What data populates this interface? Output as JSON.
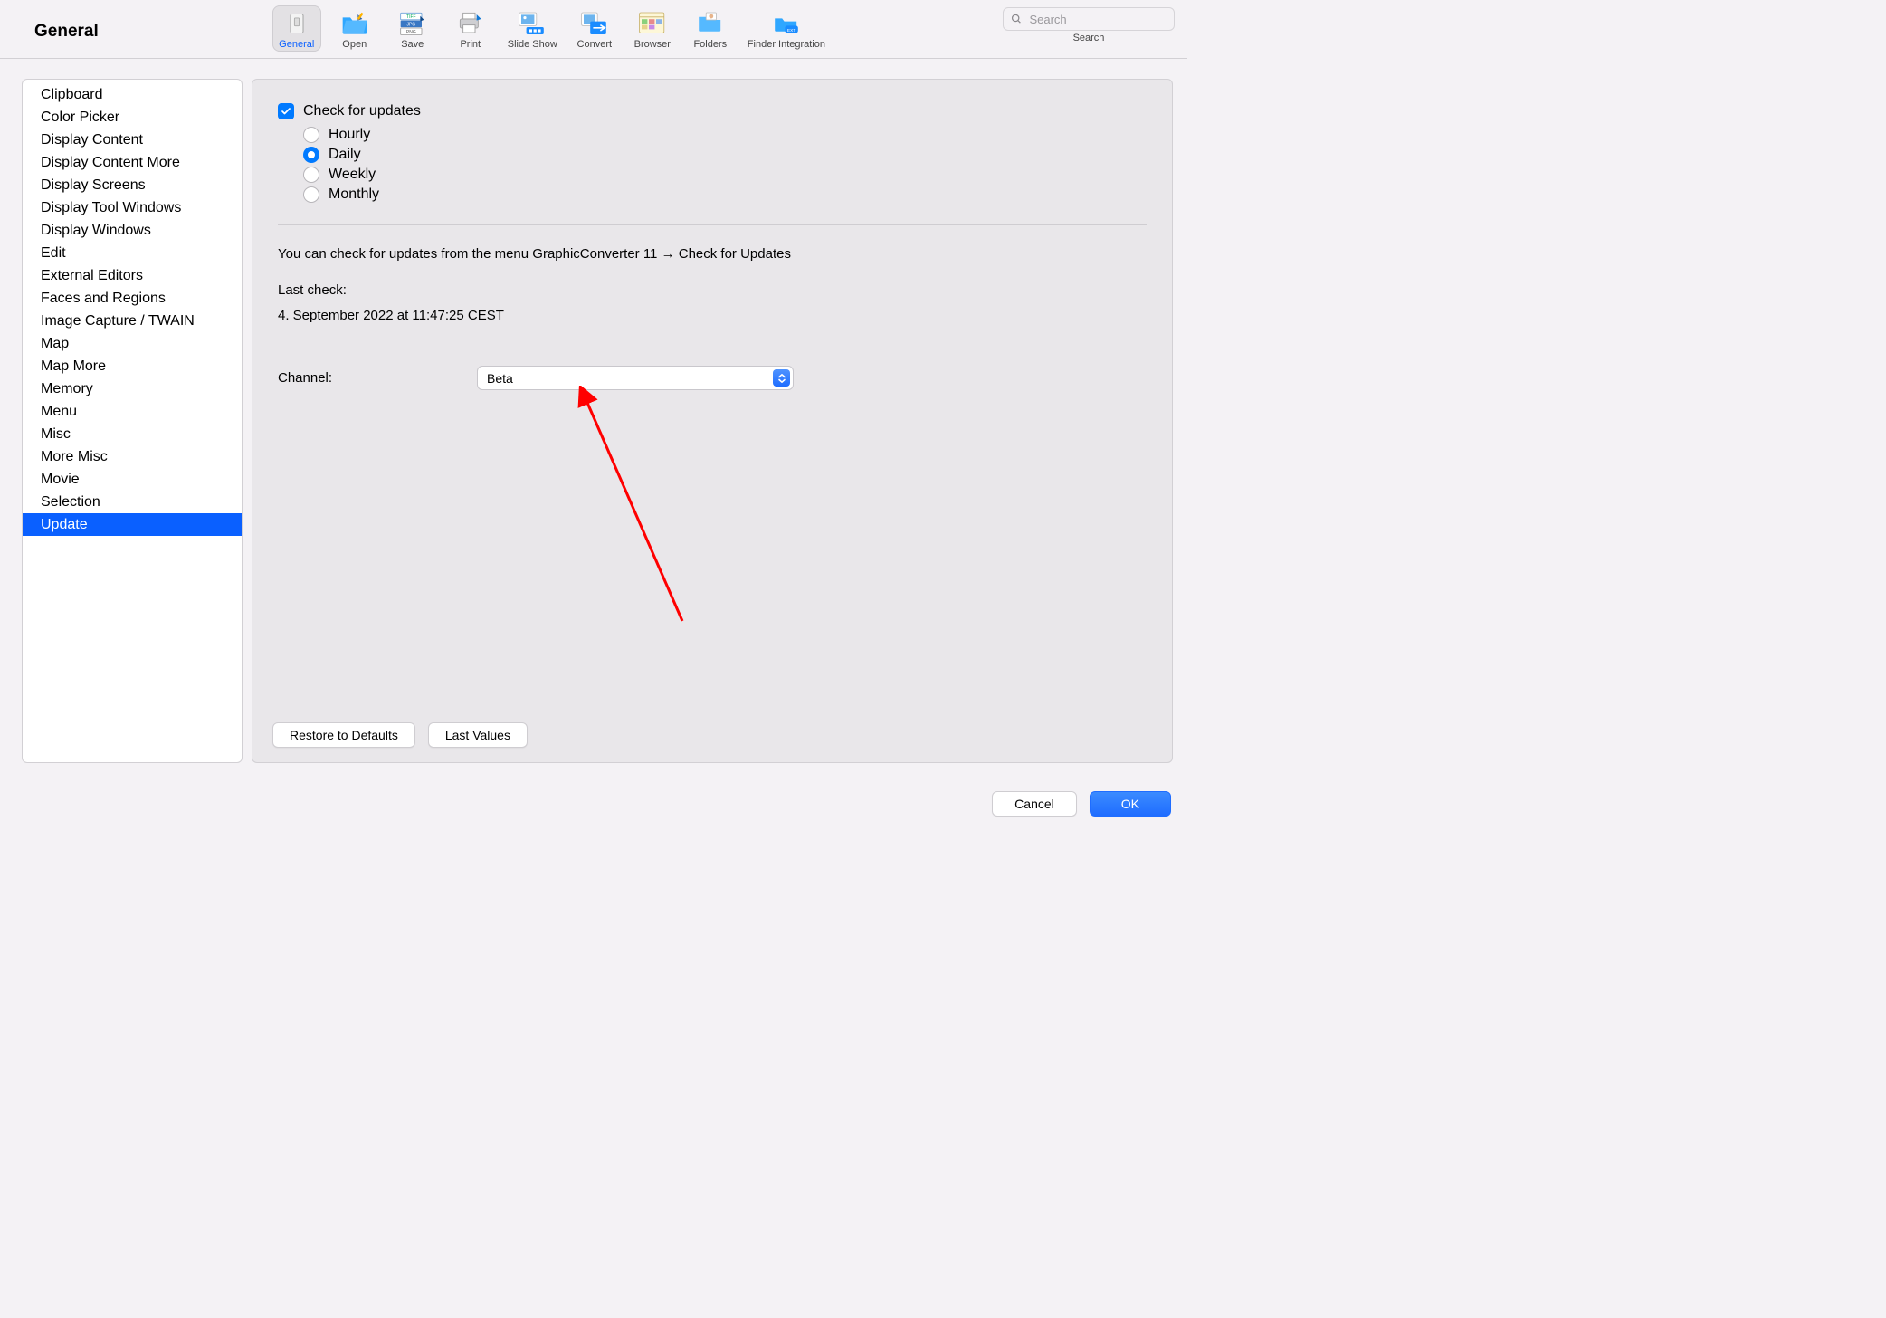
{
  "page_title": "General",
  "toolbar": {
    "items": [
      {
        "label": "General",
        "name": "tab-general",
        "icon": "general",
        "active": true
      },
      {
        "label": "Open",
        "name": "tab-open",
        "icon": "open"
      },
      {
        "label": "Save",
        "name": "tab-save",
        "icon": "save"
      },
      {
        "label": "Print",
        "name": "tab-print",
        "icon": "print"
      },
      {
        "label": "Slide Show",
        "name": "tab-slideshow",
        "icon": "slideshow"
      },
      {
        "label": "Convert",
        "name": "tab-convert",
        "icon": "convert"
      },
      {
        "label": "Browser",
        "name": "tab-browser",
        "icon": "browser"
      },
      {
        "label": "Folders",
        "name": "tab-folders",
        "icon": "folders"
      },
      {
        "label": "Finder Integration",
        "name": "tab-finder",
        "icon": "finder"
      }
    ]
  },
  "search": {
    "placeholder": "Search",
    "label": "Search"
  },
  "sidebar": {
    "items": [
      "Clipboard",
      "Color Picker",
      "Display Content",
      "Display Content More",
      "Display Screens",
      "Display Tool Windows",
      "Display Windows",
      "Edit",
      "External Editors",
      "Faces and Regions",
      "Image Capture / TWAIN",
      "Map",
      "Map More",
      "Memory",
      "Menu",
      "Misc",
      "More Misc",
      "Movie",
      "Selection",
      "Update"
    ],
    "selected_index": 19
  },
  "update": {
    "check_label": "Check for updates",
    "check_value": true,
    "frequency": {
      "options": [
        "Hourly",
        "Daily",
        "Weekly",
        "Monthly"
      ],
      "selected": "Daily"
    },
    "hint": "You can check for updates from the menu GraphicConverter 11 → Check for Updates",
    "last_check_label": "Last check:",
    "last_check_value": "4. September 2022 at 11:47:25 CEST",
    "channel_label": "Channel:",
    "channel_value": "Beta"
  },
  "main_buttons": {
    "restore": "Restore to Defaults",
    "last": "Last Values"
  },
  "footer": {
    "cancel": "Cancel",
    "ok": "OK"
  },
  "colors": {
    "accent": "#007AFF"
  },
  "annotation": {
    "type": "arrow",
    "color": "#FF0000"
  }
}
